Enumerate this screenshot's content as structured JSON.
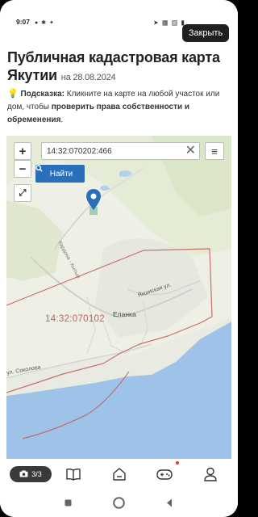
{
  "status_bar": {
    "time": "9:07",
    "left_icons": "● ✱ ✦",
    "right_icons": "➤ ▦ ▥ ▮"
  },
  "overlay": {
    "close_label": "Закрыть"
  },
  "header": {
    "title": "Публичная кадастровая карта Якутии",
    "date": "на 28.08.2024"
  },
  "hint": {
    "bulb": "💡",
    "label": "Подсказка:",
    "text_before": " Кликните на карте на любой участок или дом, чтобы ",
    "bold_text": "проверить права собственности и обременения",
    "text_after": "."
  },
  "map": {
    "zoom_in": "+",
    "zoom_out": "−",
    "fullscreen": "⤢",
    "search_value": "14:32:070202:466",
    "clear": "✕",
    "menu": "≡",
    "find_label": "Найти",
    "parcel_label": "14:32:070102",
    "place_label": "Еланка",
    "street_label_1": "Якшиская ул.",
    "street_label_2": "ул. Соколова",
    "road_label": "Кардона - Кытыл"
  },
  "bottom_nav": {
    "photo_counter": "3/3"
  },
  "colors": {
    "accent": "#2a6fba",
    "parcel_border": "#c9706b",
    "water": "#9ec2e8",
    "greenery": "#dfe8cf"
  }
}
